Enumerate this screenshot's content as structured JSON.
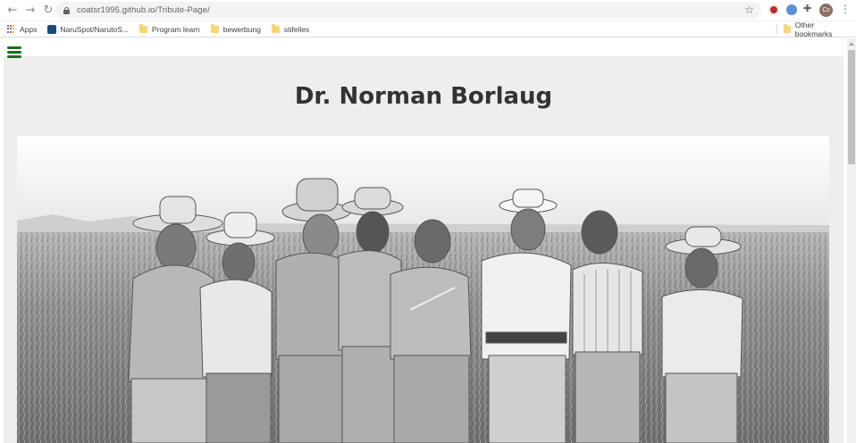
{
  "browser": {
    "url": "coatsr1995.github.io/Tribute-Page/",
    "profile_initials": "Cs"
  },
  "bookmarks": {
    "items": [
      {
        "label": "Apps",
        "icon": "apps-grid-icon"
      },
      {
        "label": "NaruSpot/NarutoS...",
        "icon": "naruspot-icon"
      },
      {
        "label": "Program learn",
        "icon": "folder-icon"
      },
      {
        "label": "bewerbung",
        "icon": "folder-icon"
      },
      {
        "label": "stifelles",
        "icon": "folder-icon"
      }
    ],
    "other": "Other bookmarks"
  },
  "page": {
    "title": "Dr. Norman Borlaug",
    "image_alt": "Dr. Norman Borlaug with farmers in a wheat field",
    "accent_color": "#1e6b1e",
    "background_color": "#eeeeee"
  }
}
